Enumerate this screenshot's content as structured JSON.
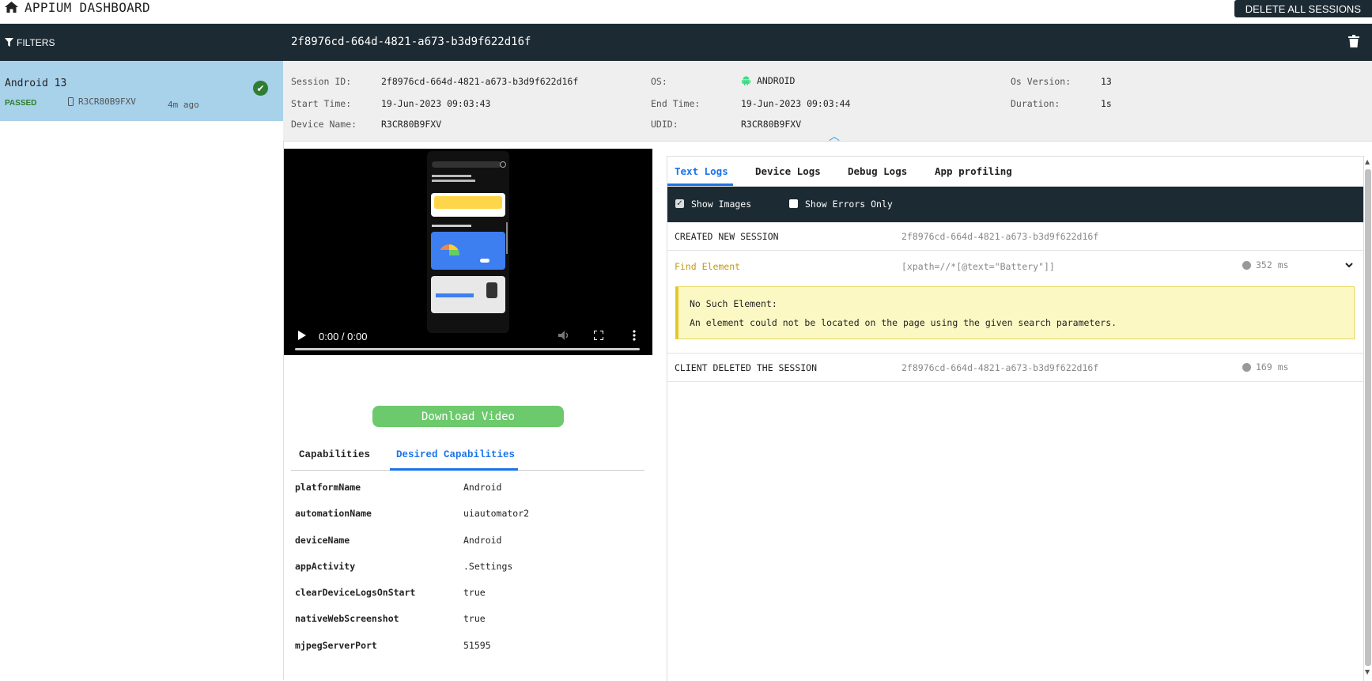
{
  "app": {
    "title": "APPIUM DASHBOARD",
    "delete_all_label": "DELETE ALL SESSIONS"
  },
  "sidebar": {
    "filters_label": "FILTERS",
    "sessions": [
      {
        "name": "Android 13",
        "status": "PASSED",
        "device": "R3CR80B9FXV",
        "ago": "4m ago"
      }
    ]
  },
  "session": {
    "id": "2f8976cd-664d-4821-a673-b3d9f622d16f",
    "info": {
      "session_id_label": "Session ID:",
      "session_id": "2f8976cd-664d-4821-a673-b3d9f622d16f",
      "start_time_label": "Start Time:",
      "start_time": "19-Jun-2023 09:03:43",
      "device_name_label": "Device Name:",
      "device_name": "R3CR80B9FXV",
      "os_label": "OS:",
      "os": "ANDROID",
      "end_time_label": "End Time:",
      "end_time": "19-Jun-2023 09:03:44",
      "udid_label": "UDID:",
      "udid": "R3CR80B9FXV",
      "os_version_label": "Os Version:",
      "os_version": "13",
      "duration_label": "Duration:",
      "duration": "1s"
    }
  },
  "video": {
    "time": "0:00 / 0:00",
    "download_label": "Download Video"
  },
  "capabilities": {
    "tabs": [
      "Capabilities",
      "Desired Capabilities"
    ],
    "active_tab": 1,
    "rows": [
      {
        "key": "platformName",
        "value": "Android"
      },
      {
        "key": "automationName",
        "value": "uiautomator2"
      },
      {
        "key": "deviceName",
        "value": "Android"
      },
      {
        "key": "appActivity",
        "value": ".Settings"
      },
      {
        "key": "clearDeviceLogsOnStart",
        "value": "true"
      },
      {
        "key": "nativeWebScreenshot",
        "value": "true"
      },
      {
        "key": "mjpegServerPort",
        "value": "51595"
      }
    ]
  },
  "logs": {
    "tabs": [
      "Text Logs",
      "Device Logs",
      "Debug Logs",
      "App profiling"
    ],
    "active_tab": 0,
    "show_images_label": "Show Images",
    "show_images_checked": true,
    "show_errors_label": "Show Errors Only",
    "show_errors_checked": false,
    "entries": [
      {
        "command": "CREATED NEW SESSION",
        "args": "2f8976cd-664d-4821-a673-b3d9f622d16f",
        "duration": ""
      },
      {
        "command": "Find Element",
        "args": "[xpath=//*[@text=\"Battery\"]]",
        "duration": "352 ms"
      },
      {
        "command": "CLIENT DELETED THE SESSION",
        "args": "2f8976cd-664d-4821-a673-b3d9f622d16f",
        "duration": "169 ms"
      }
    ],
    "error": {
      "title": "No Such Element:",
      "message": "An element could not be located on the page using the given search parameters."
    }
  },
  "colors": {
    "header_bg": "#1c2a33",
    "accent": "#1a73e8",
    "passed": "#2e7d32",
    "selected_session": "#a8d1ea",
    "download": "#6cc96c",
    "error_bg": "#fcf8c4",
    "find_element": "#c49a1a"
  }
}
